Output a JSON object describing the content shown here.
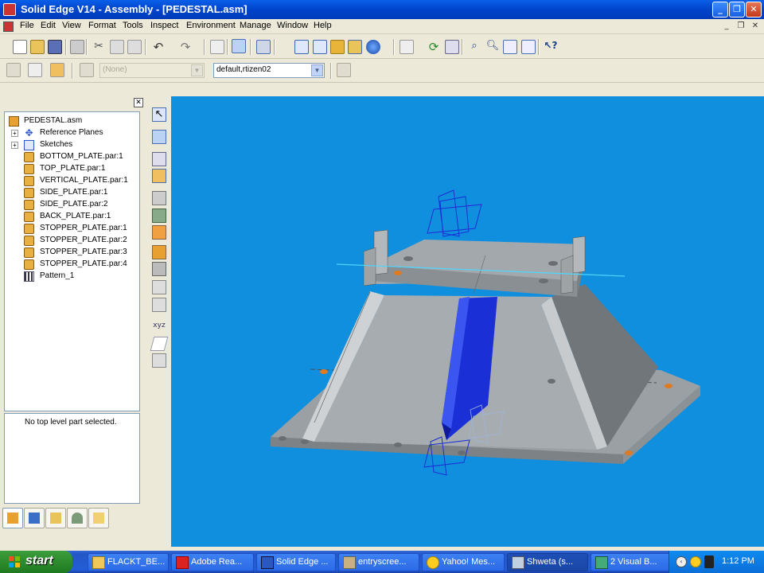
{
  "window": {
    "title": "Solid Edge V14 - Assembly - [PEDESTAL.asm]",
    "controls": [
      "minimize",
      "maximize",
      "close"
    ]
  },
  "menu": {
    "items": [
      "File",
      "Edit",
      "View",
      "Format",
      "Tools",
      "Inspect",
      "Environment",
      "Manage",
      "Window",
      "Help"
    ]
  },
  "toolbar2": {
    "style_combo_value": "(None)",
    "layer_combo_value": "default,rtizen02"
  },
  "pathfinder": {
    "root": "PEDESTAL.asm",
    "items": [
      {
        "label": "Reference Planes",
        "icon": "reference-planes-icon",
        "expandable": true
      },
      {
        "label": "Sketches",
        "icon": "sketches-icon",
        "expandable": true
      },
      {
        "label": "BOTTOM_PLATE.par:1",
        "icon": "part-icon"
      },
      {
        "label": "TOP_PLATE.par:1",
        "icon": "part-icon"
      },
      {
        "label": "VERTICAL_PLATE.par:1",
        "icon": "part-icon"
      },
      {
        "label": "SIDE_PLATE.par:1",
        "icon": "part-icon"
      },
      {
        "label": "SIDE_PLATE.par:2",
        "icon": "part-icon"
      },
      {
        "label": "BACK_PLATE.par:1",
        "icon": "part-icon"
      },
      {
        "label": "STOPPER_PLATE.par:1",
        "icon": "part-icon"
      },
      {
        "label": "STOPPER_PLATE.par:2",
        "icon": "part-icon"
      },
      {
        "label": "STOPPER_PLATE.par:3",
        "icon": "part-icon"
      },
      {
        "label": "STOPPER_PLATE.par:4",
        "icon": "part-icon"
      },
      {
        "label": "Pattern_1",
        "icon": "pattern-icon"
      }
    ]
  },
  "info_panel": {
    "text": "No top level part selected."
  },
  "viewport": {
    "background": "#0f8fdd"
  },
  "taskbar": {
    "start_label": "start",
    "items": [
      {
        "label": "FLACKT_BE...",
        "icon": "folder-icon"
      },
      {
        "label": "Adobe Rea...",
        "icon": "adobe-reader-icon"
      },
      {
        "label": "Solid Edge ...",
        "icon": "solid-edge-icon"
      },
      {
        "label": "entryscree...",
        "icon": "app-icon"
      },
      {
        "label": "Yahoo! Mes...",
        "icon": "yahoo-messenger-icon"
      },
      {
        "label": "Shweta  (s...",
        "icon": "chat-icon",
        "active": true
      },
      {
        "label": "2 Visual B...",
        "icon": "visual-basic-icon"
      }
    ],
    "clock": "1:12 PM"
  }
}
